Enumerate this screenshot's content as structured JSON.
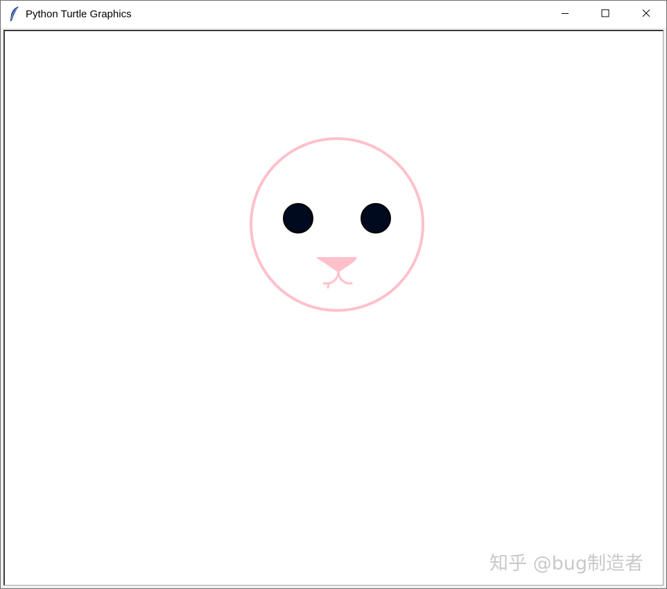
{
  "window": {
    "title": "Python Turtle Graphics",
    "icon": "feather-icon",
    "controls": {
      "minimize": "minimize-icon",
      "maximize": "maximize-icon",
      "close": "close-icon"
    }
  },
  "canvas": {
    "background": "#ffffff",
    "drawing": {
      "face_outline_color": "#ffc0cb",
      "eye_color": "#000a1e",
      "eye_outline_color": "#000000",
      "nose_color": "#ffc0cb",
      "mouth_color": "#ffc0cb"
    }
  },
  "watermark": {
    "text": "知乎 @bug制造者",
    "color": "#c9c9c9"
  }
}
